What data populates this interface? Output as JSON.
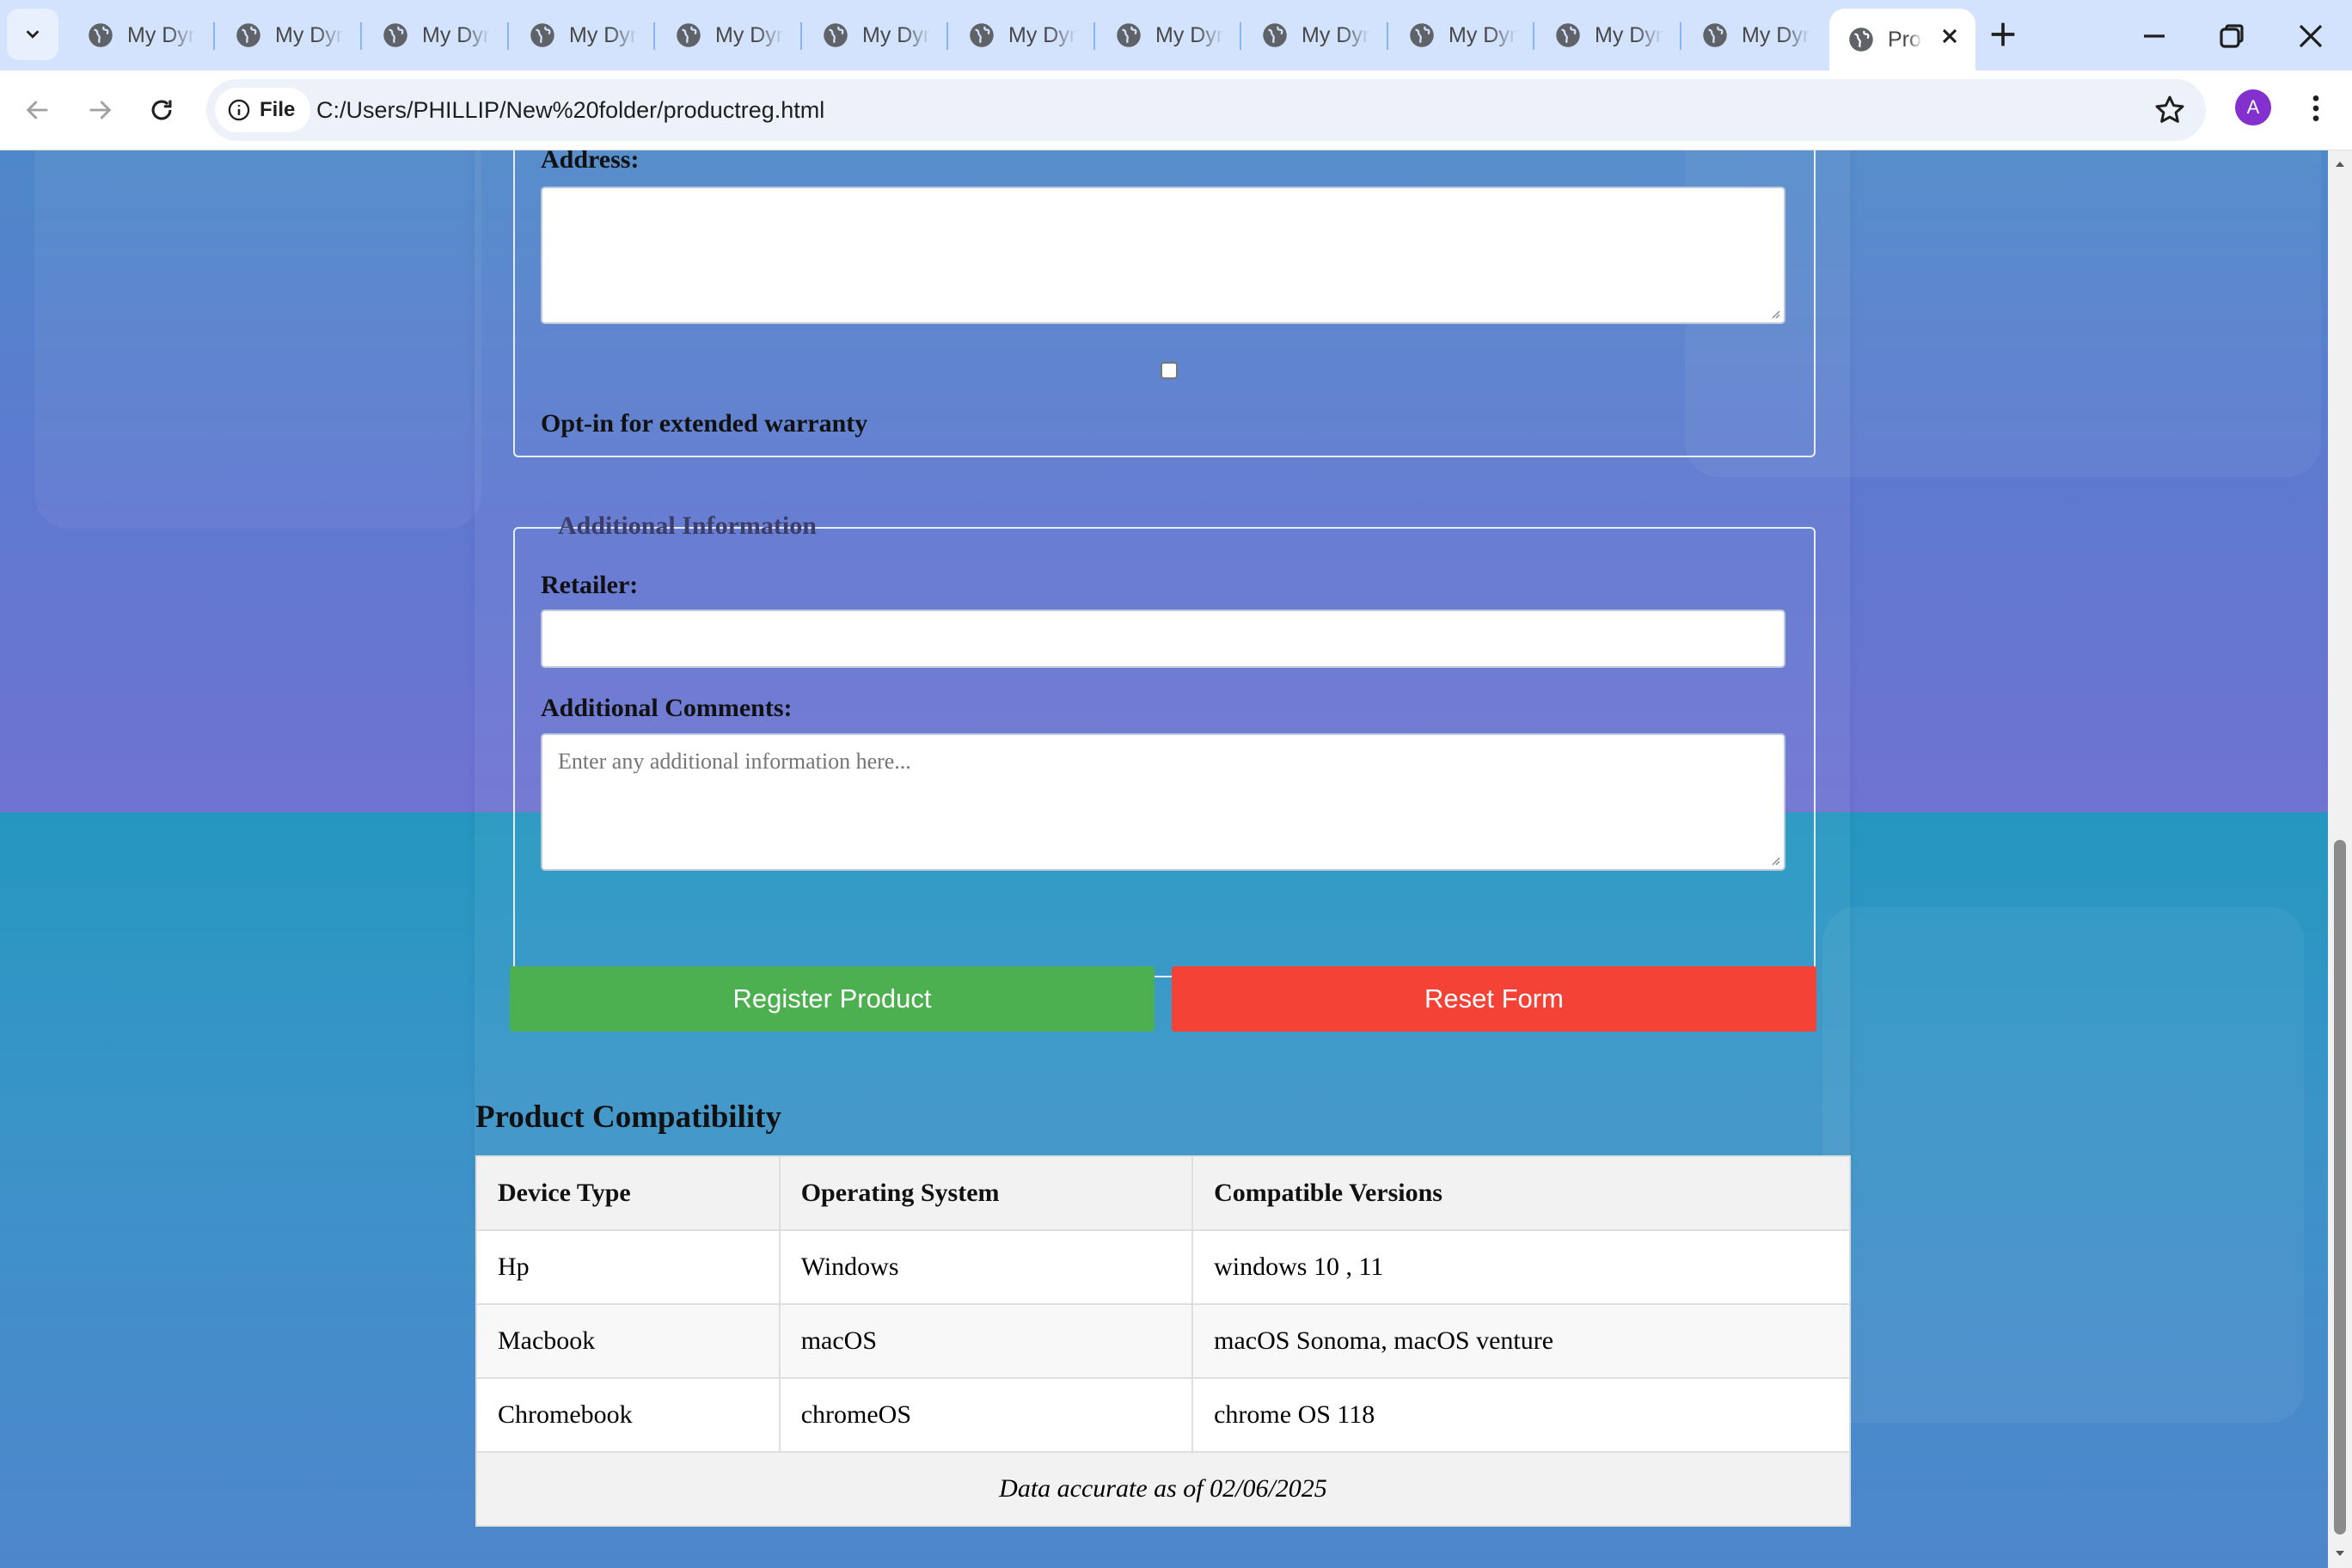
{
  "browser": {
    "tabs": [
      {
        "label": "My Dynamic"
      },
      {
        "label": "My Dynamic"
      },
      {
        "label": "My Dynamic"
      },
      {
        "label": "My Dynamic"
      },
      {
        "label": "My Dynamic"
      },
      {
        "label": "My Dynamic"
      },
      {
        "label": "My Dynamic"
      },
      {
        "label": "My Dynamic"
      },
      {
        "label": "My Dynamic"
      },
      {
        "label": "My Dynamic"
      },
      {
        "label": "My Dynamic"
      },
      {
        "label": "My Dynamic"
      }
    ],
    "active_tab": {
      "label": "Product"
    },
    "chip_label": "File",
    "url": "C:/Users/PHILLIP/New%20folder/productreg.html",
    "avatar_letter": "A"
  },
  "form": {
    "address_label": "Address:",
    "warranty_label": "Opt-in for extended warranty",
    "additional_legend": "Additional Information",
    "retailer_label": "Retailer:",
    "comments_label": "Additional Comments:",
    "comments_placeholder": "Enter any additional information here...",
    "register_button": "Register Product",
    "reset_button": "Reset Form"
  },
  "compatibility": {
    "title": "Product Compatibility",
    "headers": [
      "Device Type",
      "Operating System",
      "Compatible Versions"
    ],
    "rows": [
      [
        "Hp",
        "Windows",
        "windows 10 , 11"
      ],
      [
        "Macbook",
        "macOS",
        "macOS Sonoma, macOS venture"
      ],
      [
        "Chromebook",
        "chromeOS",
        "chrome OS 118"
      ]
    ],
    "footer": "Data accurate as of 02/06/2025"
  },
  "colors": {
    "register": "#4caf50",
    "reset": "#f44336",
    "avatar": "#8430ce"
  }
}
